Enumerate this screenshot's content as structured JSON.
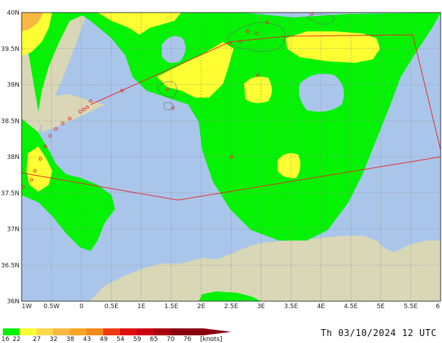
{
  "map": {
    "lat_labels": [
      "40N",
      "39.5N",
      "39N",
      "38.5N",
      "38N",
      "37.5N",
      "37N",
      "36.5N",
      "36N"
    ],
    "lon_labels": [
      "1W",
      "0.5W",
      "0",
      "0.5E",
      "1E",
      "1.5E",
      "2E",
      "2.5E",
      "3E",
      "3.5E",
      "4E",
      "4.5E",
      "5E",
      "5.5E",
      "6"
    ],
    "colors": {
      "sea": "#a9c6ea",
      "land": "#d9d7b6",
      "wind_16_22": "#05f205",
      "wind_22_27": "#ffff33",
      "wind_27_32": "#ffd84a",
      "wind_32_38": "#f6b842",
      "box": "#ee2222",
      "grid": "#888888"
    }
  },
  "legend": {
    "labels": [
      "16",
      "22",
      "27",
      "32",
      "38",
      "43",
      "49",
      "54",
      "59",
      "65",
      "70",
      "76",
      "[knots]"
    ],
    "colors": [
      "#05f205",
      "#ffff33",
      "#ffd84a",
      "#f6b842",
      "#f4a623",
      "#f28a1a",
      "#ee3a10",
      "#e01010",
      "#c80010",
      "#a80010",
      "#8a0010",
      "#8a0010"
    ]
  },
  "timestamp": "Th 03/10/2024 12 UTC"
}
